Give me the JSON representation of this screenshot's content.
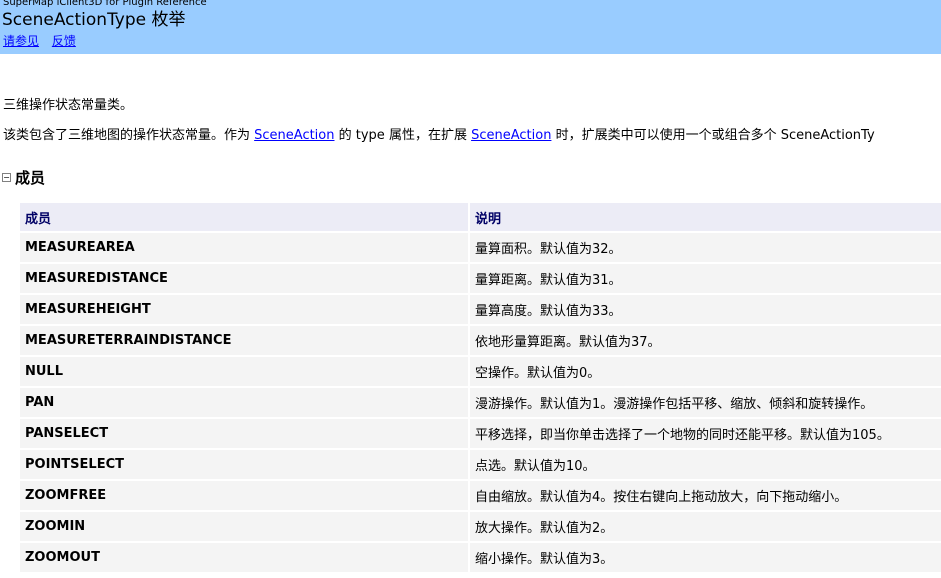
{
  "header": {
    "product": "SuperMap iClient3D for Plugin Reference",
    "title": "SceneActionType 枚举",
    "links": [
      "请参见",
      "反馈"
    ]
  },
  "summary": "三维操作状态常量类。",
  "description": {
    "prefix": "该类包含了三维地图的操作状态常量。作为 ",
    "link1": "SceneAction",
    "middle": " 的 type 属性，在扩展 ",
    "link2": "SceneAction",
    "suffix": " 时，扩展类中可以使用一个或组合多个 SceneActionTy"
  },
  "section": {
    "toggle": "−",
    "title": "成员"
  },
  "table": {
    "headers": [
      "成员",
      "说明"
    ],
    "rows": [
      {
        "name": "MEASUREAREA",
        "desc": "量算面积。默认值为32。"
      },
      {
        "name": "MEASUREDISTANCE",
        "desc": "量算距离。默认值为31。"
      },
      {
        "name": "MEASUREHEIGHT",
        "desc": "量算高度。默认值为33。"
      },
      {
        "name": "MEASURETERRAINDISTANCE",
        "desc": "依地形量算距离。默认值为37。"
      },
      {
        "name": "NULL",
        "desc": "空操作。默认值为0。"
      },
      {
        "name": "PAN",
        "desc": "漫游操作。默认值为1。漫游操作包括平移、缩放、倾斜和旋转操作。"
      },
      {
        "name": "PANSELECT",
        "desc": "平移选择，即当你单击选择了一个地物的同时还能平移。默认值为105。"
      },
      {
        "name": "POINTSELECT",
        "desc": "点选。默认值为10。"
      },
      {
        "name": "ZOOMFREE",
        "desc": "自由缩放。默认值为4。按住右键向上拖动放大，向下拖动缩小。"
      },
      {
        "name": "ZOOMIN",
        "desc": "放大操作。默认值为2。"
      },
      {
        "name": "ZOOMOUT",
        "desc": "缩小操作。默认值为3。"
      }
    ]
  }
}
